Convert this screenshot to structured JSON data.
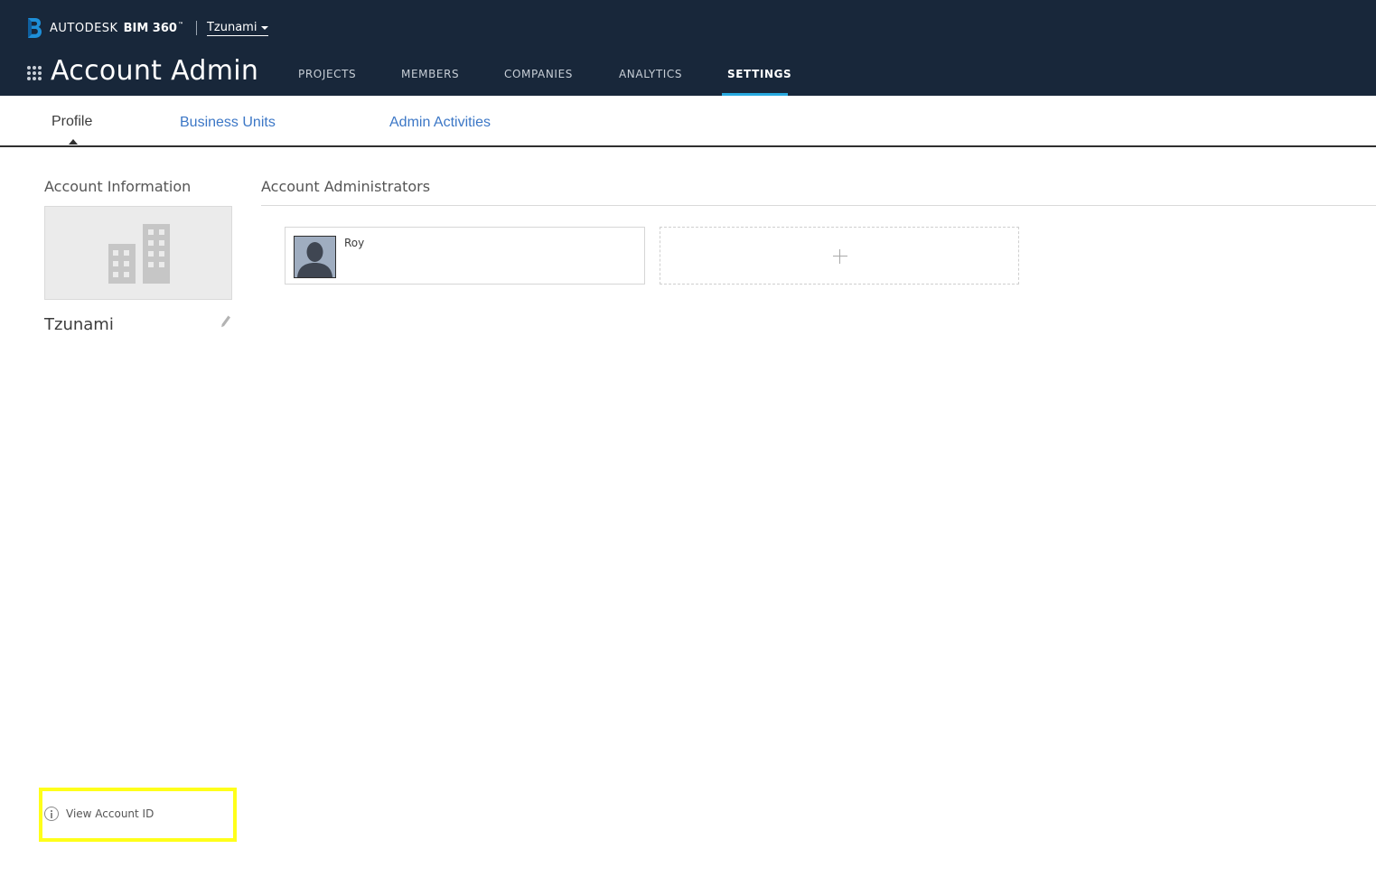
{
  "header": {
    "brand": "AUTODESK",
    "product": "BIM 360",
    "trademark": "™",
    "account_switcher": "Tzunami",
    "app_title": "Account Admin",
    "nav": [
      {
        "label": "PROJECTS",
        "active": false
      },
      {
        "label": "MEMBERS",
        "active": false
      },
      {
        "label": "COMPANIES",
        "active": false
      },
      {
        "label": "ANALYTICS",
        "active": false
      },
      {
        "label": "SETTINGS",
        "active": true
      }
    ],
    "accent_color": "#28a9e0",
    "background_color": "#18273a"
  },
  "subnav": {
    "tabs": [
      {
        "label": "Profile",
        "active": true
      },
      {
        "label": "Business Units",
        "active": false
      },
      {
        "label": "Admin Activities",
        "active": false
      }
    ],
    "link_color": "#3c77c6"
  },
  "account_info": {
    "heading": "Account Information",
    "image_icon": "building-icon",
    "name": "Tzunami",
    "edit_icon": "pencil-icon"
  },
  "admins": {
    "heading": "Account Administrators",
    "list": [
      {
        "name": "Roy",
        "avatar_icon": "default-user-avatar"
      }
    ],
    "add_icon": "plus-icon"
  },
  "footer": {
    "view_account_id": "View Account ID",
    "info_icon": "info-icon",
    "highlight_color": "#ffff1a"
  }
}
